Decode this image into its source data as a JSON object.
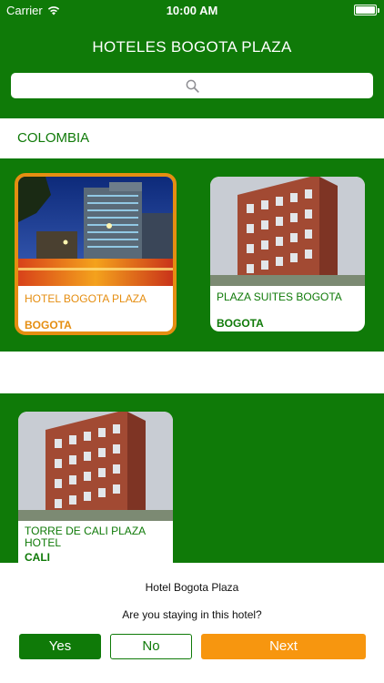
{
  "status_bar": {
    "carrier": "Carrier",
    "time": "10:00 AM"
  },
  "nav": {
    "title": "HOTELES BOGOTA PLAZA"
  },
  "search": {
    "placeholder": ""
  },
  "section": {
    "title": "COLOMBIA"
  },
  "hotels": [
    {
      "name": "HOTEL BOGOTA PLAZA",
      "city": "BOGOTA",
      "selected": true,
      "image": "night-hotel-photo"
    },
    {
      "name": "PLAZA SUITES BOGOTA",
      "city": "BOGOTA",
      "selected": false,
      "image": "brick-building-photo"
    },
    {
      "name": "TORRE DE CALI PLAZA HOTEL",
      "city": "CALI",
      "selected": false,
      "image": "brick-building-photo"
    }
  ],
  "prompt": {
    "hotel_name": "Hotel Bogota Plaza",
    "question": "Are you staying in this hotel?",
    "yes_label": "Yes",
    "no_label": "No",
    "next_label": "Next"
  },
  "colors": {
    "brand_green": "#0f7a08",
    "accent_orange": "#f7960f",
    "selected_border": "#e58e11"
  }
}
